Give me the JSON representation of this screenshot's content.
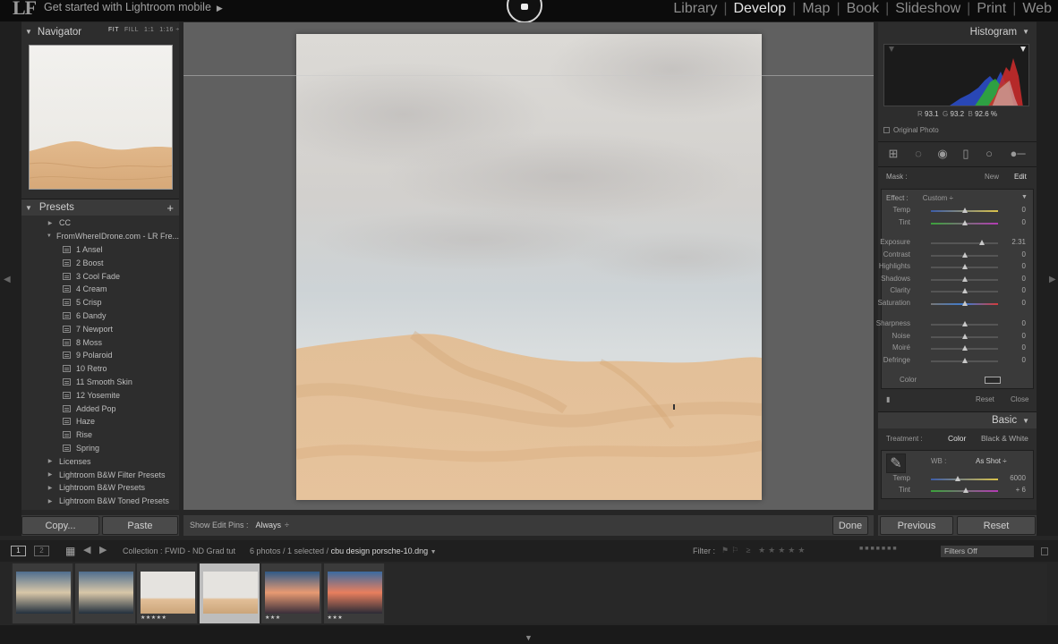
{
  "app": {
    "logo": "LF",
    "mobile_link": "Get started with Lightroom mobile"
  },
  "modules": [
    {
      "label": "Library",
      "active": false
    },
    {
      "label": "Develop",
      "active": true
    },
    {
      "label": "Map",
      "active": false
    },
    {
      "label": "Book",
      "active": false
    },
    {
      "label": "Slideshow",
      "active": false
    },
    {
      "label": "Print",
      "active": false
    },
    {
      "label": "Web",
      "active": false
    }
  ],
  "navigator": {
    "title": "Navigator",
    "options": [
      "FIT",
      "FILL",
      "1:1",
      "1:16"
    ]
  },
  "presets": {
    "title": "Presets",
    "add": "+",
    "items": [
      {
        "label": "CC",
        "type": "folder-collapsed"
      },
      {
        "label": "FromWhereIDrone.com - LR Fre...",
        "type": "folder-open"
      },
      {
        "label": "1 Ansel",
        "type": "preset"
      },
      {
        "label": "2 Boost",
        "type": "preset"
      },
      {
        "label": "3 Cool Fade",
        "type": "preset"
      },
      {
        "label": "4 Cream",
        "type": "preset"
      },
      {
        "label": "5 Crisp",
        "type": "preset"
      },
      {
        "label": "6 Dandy",
        "type": "preset"
      },
      {
        "label": "7 Newport",
        "type": "preset"
      },
      {
        "label": "8 Moss",
        "type": "preset"
      },
      {
        "label": "9 Polaroid",
        "type": "preset"
      },
      {
        "label": "10 Retro",
        "type": "preset"
      },
      {
        "label": "11 Smooth Skin",
        "type": "preset"
      },
      {
        "label": "12 Yosemite",
        "type": "preset"
      },
      {
        "label": "Added Pop",
        "type": "preset"
      },
      {
        "label": "Haze",
        "type": "preset"
      },
      {
        "label": "Rise",
        "type": "preset"
      },
      {
        "label": "Spring",
        "type": "preset"
      },
      {
        "label": "Licenses",
        "type": "folder-collapsed"
      },
      {
        "label": "Lightroom B&W Filter Presets",
        "type": "folder-collapsed"
      },
      {
        "label": "Lightroom B&W Presets",
        "type": "folder-collapsed"
      },
      {
        "label": "Lightroom B&W Toned Presets",
        "type": "folder-collapsed"
      }
    ]
  },
  "left_buttons": {
    "copy": "Copy...",
    "paste": "Paste"
  },
  "toolbar": {
    "edit_pins_label": "Show Edit Pins :",
    "edit_pins_value": "Always",
    "done": "Done"
  },
  "histogram": {
    "title": "Histogram",
    "r_label": "R",
    "r_value": "93.1",
    "g_label": "G",
    "g_value": "93.2",
    "b_label": "B",
    "b_value": "92.6 %",
    "original_photo": "Original Photo"
  },
  "mask": {
    "label": "Mask :",
    "new": "New",
    "edit": "Edit",
    "effect_label": "Effect :",
    "effect_value": "Custom",
    "sliders": [
      {
        "label": "Temp",
        "value": "0",
        "pos": 0.5,
        "group": 1
      },
      {
        "label": "Tint",
        "value": "0",
        "pos": 0.5,
        "group": 1
      },
      {
        "label": "Exposure",
        "value": "2.31",
        "pos": 0.76,
        "group": 2
      },
      {
        "label": "Contrast",
        "value": "0",
        "pos": 0.5,
        "group": 2
      },
      {
        "label": "Highlights",
        "value": "0",
        "pos": 0.5,
        "group": 2
      },
      {
        "label": "Shadows",
        "value": "0",
        "pos": 0.5,
        "group": 2
      },
      {
        "label": "Clarity",
        "value": "0",
        "pos": 0.5,
        "group": 2
      },
      {
        "label": "Saturation",
        "value": "0",
        "pos": 0.5,
        "group": 2
      },
      {
        "label": "Sharpness",
        "value": "0",
        "pos": 0.5,
        "group": 3
      },
      {
        "label": "Noise",
        "value": "0",
        "pos": 0.5,
        "group": 3
      },
      {
        "label": "Moiré",
        "value": "0",
        "pos": 0.5,
        "group": 3
      },
      {
        "label": "Defringe",
        "value": "0",
        "pos": 0.5,
        "group": 3
      }
    ],
    "color_label": "Color",
    "reset": "Reset",
    "close": "Close"
  },
  "basic": {
    "title": "Basic",
    "treatment_label": "Treatment :",
    "treatment_color": "Color",
    "treatment_bw": "Black & White",
    "wb_label": "WB :",
    "wb_value": "As Shot",
    "sliders": [
      {
        "label": "Temp",
        "value": "6000",
        "pos": 0.4
      },
      {
        "label": "Tint",
        "value": "+ 6",
        "pos": 0.52
      }
    ]
  },
  "right_buttons": {
    "previous": "Previous",
    "reset": "Reset"
  },
  "filmstrip": {
    "screen1": "1",
    "screen2": "2",
    "collection": "Collection : FWID - ND Grad tut",
    "count": "6 photos / 1 selected /",
    "filename": "cbu design porsche-10.dng",
    "filter_label": "Filter :",
    "filters_off": "Filters Off",
    "thumbs": [
      {
        "kind": "beach",
        "stars": "",
        "selected": false
      },
      {
        "kind": "beach",
        "stars": "",
        "selected": false
      },
      {
        "kind": "dune",
        "stars": "★★★★★",
        "selected": false
      },
      {
        "kind": "dune",
        "stars": "",
        "selected": true
      },
      {
        "kind": "sunset",
        "stars": "★★★",
        "selected": false
      },
      {
        "kind": "sunset2",
        "stars": "★★★",
        "selected": false
      }
    ]
  }
}
